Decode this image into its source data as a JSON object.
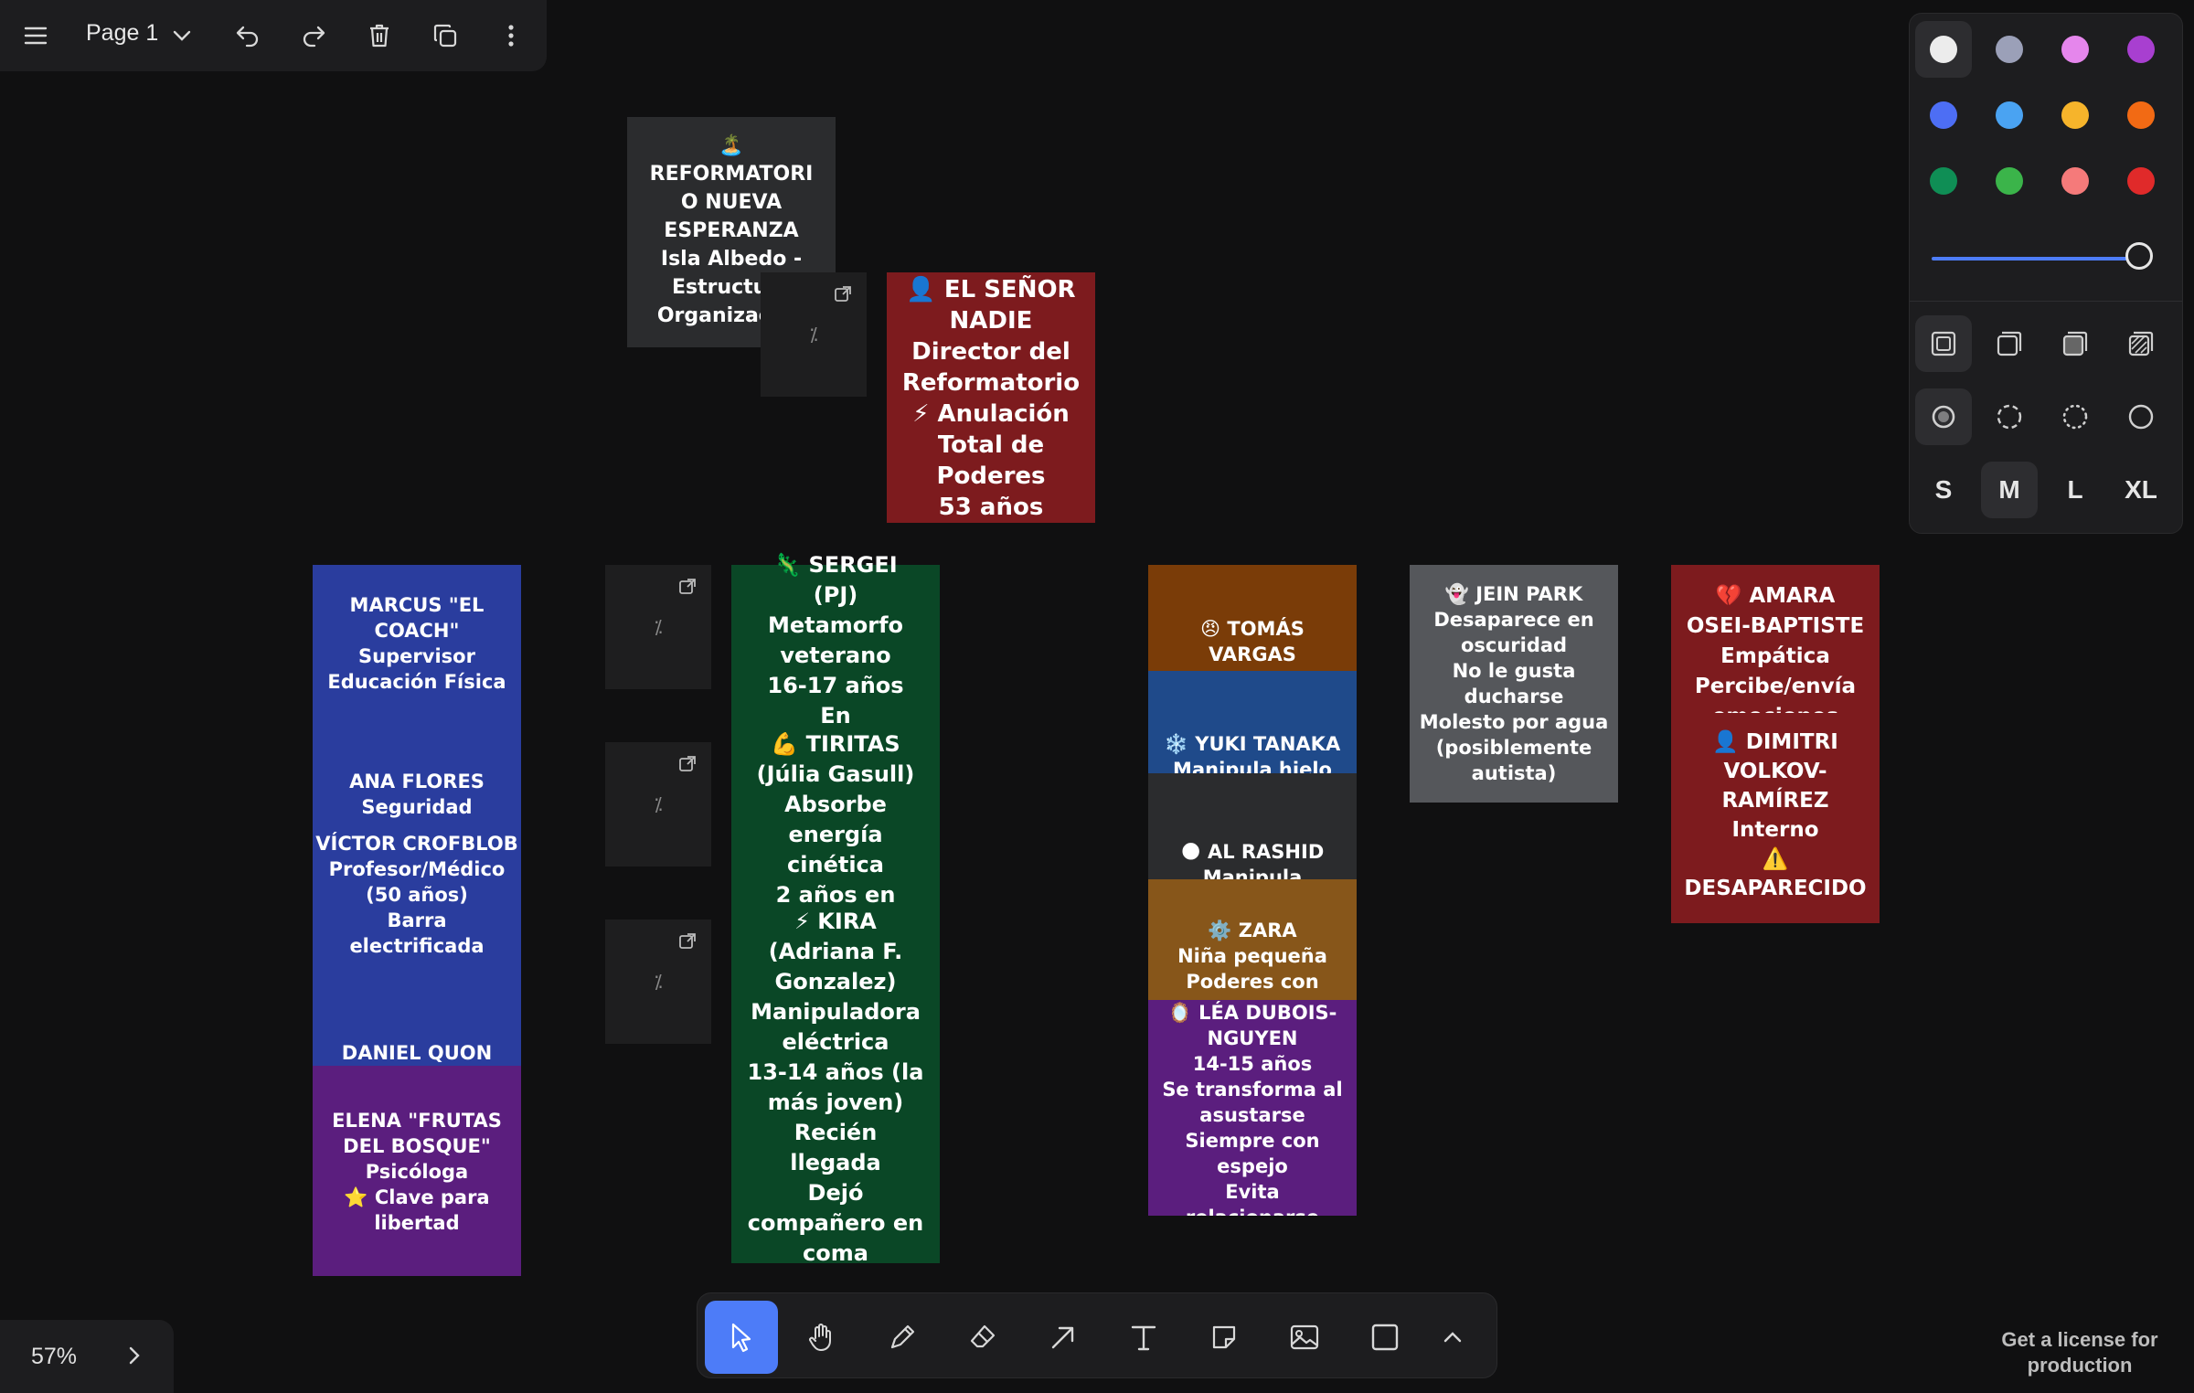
{
  "menu": {
    "page_name": "Page 1"
  },
  "zoom": {
    "level": "57%"
  },
  "license": "Get a license for production",
  "notes": {
    "reformatorio": "🏝️\nREFORMATORI\nO NUEVA\nESPERANZA\nIsla Albedo -\nEstructura\nOrganización",
    "senor_nadie": "👤 EL SEÑOR\nNADIE\nDirector del\nReformatorio\n⚡ Anulación\nTotal de\nPoderes\n53 años",
    "marcus": "MARCUS \"EL\nCOACH\"\nSupervisor\nEducación Física",
    "ana": "ANA FLORES\nSeguridad",
    "victor": "VÍCTOR CROFBLOB\nProfesor/Médico\n(50 años)\nBarra\nelectrificada",
    "daniel": "DANIEL QUON",
    "elena": "ELENA \"FRUTAS\nDEL BOSQUE\"\nPsicóloga\n⭐ Clave para\nlibertad",
    "sergei": "🦎 SERGEI\n(PJ)\nMetamorfo\nveterano\n16-17 años\nEn",
    "tiritas": "💪 TIRITAS\n(Júlia Gasull)\nAbsorbe\nenergía\ncinética\n2 años en",
    "kira": "⚡ KIRA\n(Adriana F.\nGonzalez)\nManipuladora\neléctrica\n13-14 años (la\nmás joven)\nRecién\nllegada\nDejó\ncompañero en\ncoma",
    "tomas": "😠 TOMÁS\nVARGAS",
    "yuki": "❄️ YUKI TANAKA\nManipula hielo",
    "al_rashid": "🌑 AL RASHID\nManipula",
    "zara": "⚙️ ZARA\nNiña pequeña\nPoderes con",
    "lea": "🪞 LÉA DUBOIS-\nNGUYEN\n14-15 años\nSe transforma al\nasustarse\nSiempre con\nespejo\nEvita\nrelacionarse",
    "jein": "👻 JEIN PARK\nDesaparece en\noscuridad\nNo le gusta\nducharse\nMolesto por agua\n(posiblemente\nautista)",
    "amara": "💔 AMARA\nOSEI-BAPTISTE\nEmpática\nPercibe/envía\nemociones",
    "dimitri": "👤 DIMITRI\nVOLKOV-\nRAMÍREZ\nInterno\n⚠️\nDESAPARECIDO"
  },
  "colors": {
    "blue_note": "#2a3d9e",
    "purple_note": "#5b1e7e",
    "green_note": "#0a4726",
    "red_note": "#7d1b1e",
    "brown_note": "#7a3c08",
    "yuki_note": "#1f4a8a",
    "dark_note": "#2b2c2e",
    "ochre_note": "#87561a",
    "grey_note": "#55575b",
    "accent": "#4d7cf8"
  },
  "style_panel": {
    "colors": [
      "#ececec",
      "#9ba0b8",
      "#e586ec",
      "#a83fd0",
      "#4d6ef4",
      "#4aa3f2",
      "#f6b42b",
      "#f26a14",
      "#0f8e55",
      "#3bb44a",
      "#f57a7a",
      "#e02a2a"
    ],
    "sizes": [
      "S",
      "M",
      "L",
      "XL"
    ],
    "selected_size": "M"
  },
  "toolbar": {
    "tools": [
      "select-tool",
      "hand-tool",
      "draw-tool",
      "eraser-tool",
      "arrow-tool",
      "text-tool",
      "note-tool",
      "image-tool",
      "rectangle-tool",
      "more-tools"
    ],
    "selected": "select-tool"
  }
}
